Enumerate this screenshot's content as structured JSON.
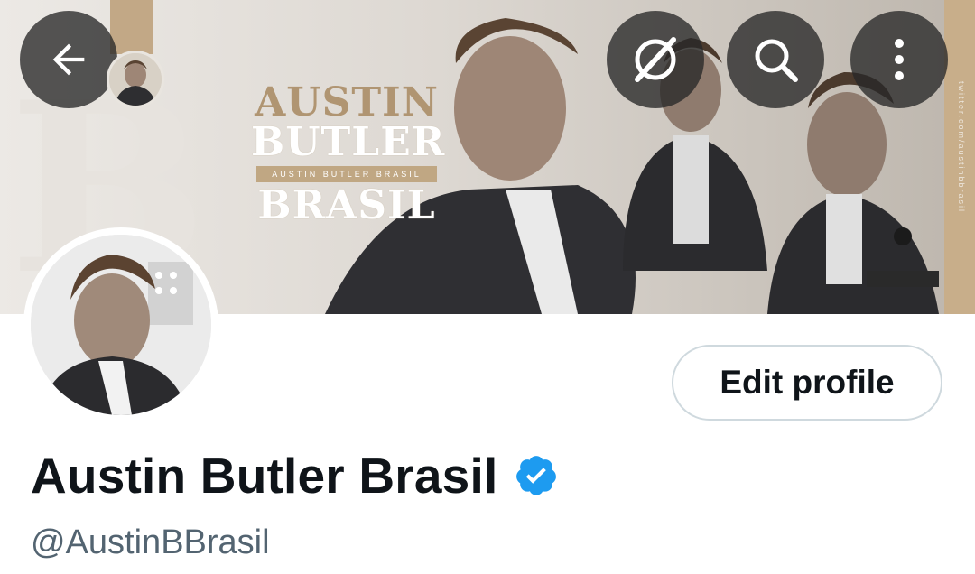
{
  "header": {
    "back_icon": "arrow-left-icon",
    "grok_icon": "grok-icon",
    "search_icon": "search-icon",
    "more_icon": "more-vertical-icon"
  },
  "banner": {
    "brand_line_1": "AUSTIN",
    "brand_line_2": "BUTLER",
    "brand_tagline": "AUSTIN BUTLER BRASIL",
    "brand_line_3": "BRASIL",
    "vertical_handle": "twitter.com/austinbbrasil",
    "colors": {
      "gold": "#b09572"
    }
  },
  "profile": {
    "display_name": "Austin Butler Brasil",
    "handle": "@AustinBBrasil",
    "verified_icon": "verified-badge-icon",
    "verified_color": "#1d9bf0",
    "edit_profile_label": "Edit profile"
  }
}
